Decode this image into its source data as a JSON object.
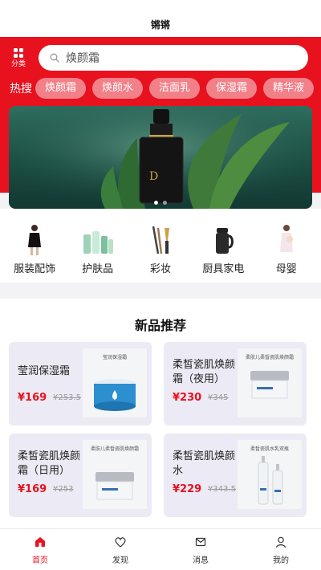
{
  "header": {
    "title": "锵锵"
  },
  "category_button": {
    "label": "分类",
    "icon": "grid-icon"
  },
  "search": {
    "placeholder": "焕颜霜",
    "icon": "search-icon"
  },
  "hot_search": {
    "label": "热搜",
    "tags": [
      "焕颜霜",
      "焕颜水",
      "洁面乳",
      "保湿霜",
      "精华液"
    ]
  },
  "banner": {
    "brand_text": "D",
    "dots": 2,
    "active_dot": 0
  },
  "categories": [
    {
      "name": "服装配饰",
      "icon": "fashion-model-icon"
    },
    {
      "name": "护肤品",
      "icon": "skincare-bottles-icon"
    },
    {
      "name": "彩妆",
      "icon": "makeup-brush-icon"
    },
    {
      "name": "厨具家电",
      "icon": "kettle-icon"
    },
    {
      "name": "母婴",
      "icon": "mother-baby-icon"
    }
  ],
  "section": {
    "title": "新品推荐"
  },
  "products": [
    {
      "name": "莹润保湿霜",
      "price": "¥169",
      "old_price": "¥253.5",
      "img_caption": "莹润保湿霜"
    },
    {
      "name": "柔皙瓷肌焕颜霜（夜用）",
      "price": "¥230",
      "old_price": "¥345",
      "img_caption": "柔肤儿柔皙瓷肌焕颜霜"
    },
    {
      "name": "柔皙瓷肌焕颜霜（日用）",
      "price": "¥169",
      "old_price": "¥253",
      "img_caption": "柔肤儿柔皙瓷肌焕颜霜"
    },
    {
      "name": "柔皙瓷肌焕颜水",
      "price": "¥229",
      "old_price": "¥343.5",
      "img_caption": "柔皙瓷肌水乳双瓶"
    }
  ],
  "tabbar": {
    "items": [
      {
        "label": "首页",
        "icon": "home-icon",
        "active": true
      },
      {
        "label": "发现",
        "icon": "heart-icon",
        "active": false
      },
      {
        "label": "消息",
        "icon": "message-icon",
        "active": false
      },
      {
        "label": "我的",
        "icon": "user-icon",
        "active": false
      }
    ]
  },
  "colors": {
    "brand_red": "#e8121f",
    "tag_bg": "#f28088",
    "card_bg": "#eceaf4"
  }
}
